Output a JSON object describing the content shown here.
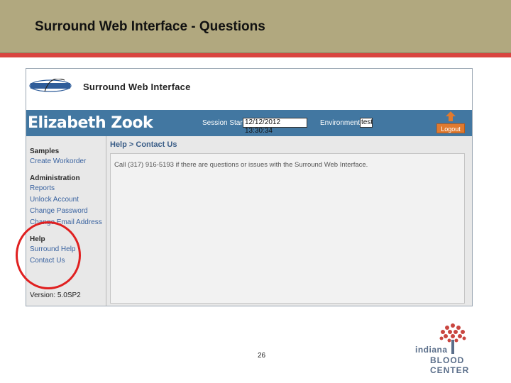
{
  "slide": {
    "title": "Surround Web Interface - Questions",
    "page_number": "26"
  },
  "app": {
    "logo_text": "Surround Web Interface",
    "user_name": "Elizabeth Zook",
    "session_start_label": "Session Start",
    "session_start_value": "12/12/2012 13:30:34",
    "environment_label": "Environment",
    "environment_value": "test",
    "logout_label": "Logout"
  },
  "sidebar": {
    "sections": [
      {
        "heading": "Samples",
        "links": [
          "Create Workorder"
        ]
      },
      {
        "heading": "Administration",
        "links": [
          "Reports",
          "Unlock Account",
          "Change Password",
          "Change Email Address"
        ]
      },
      {
        "heading": "Help",
        "links": [
          "Surround Help",
          "Contact Us"
        ]
      }
    ],
    "version": "Version: 5.0SP2"
  },
  "content": {
    "breadcrumb": "Help > Contact Us",
    "message": "Call (317) 916-5193 if there are questions or issues with the Surround Web Interface."
  },
  "branding": {
    "org_line1": "indiana",
    "org_line2": "BLOOD CENTER"
  },
  "colors": {
    "title_bar": "#b1a87f",
    "accent_red": "#d9443f",
    "app_blue": "#4277a1",
    "logout_orange": "#e07a2f",
    "highlight_circle": "#e02020"
  }
}
